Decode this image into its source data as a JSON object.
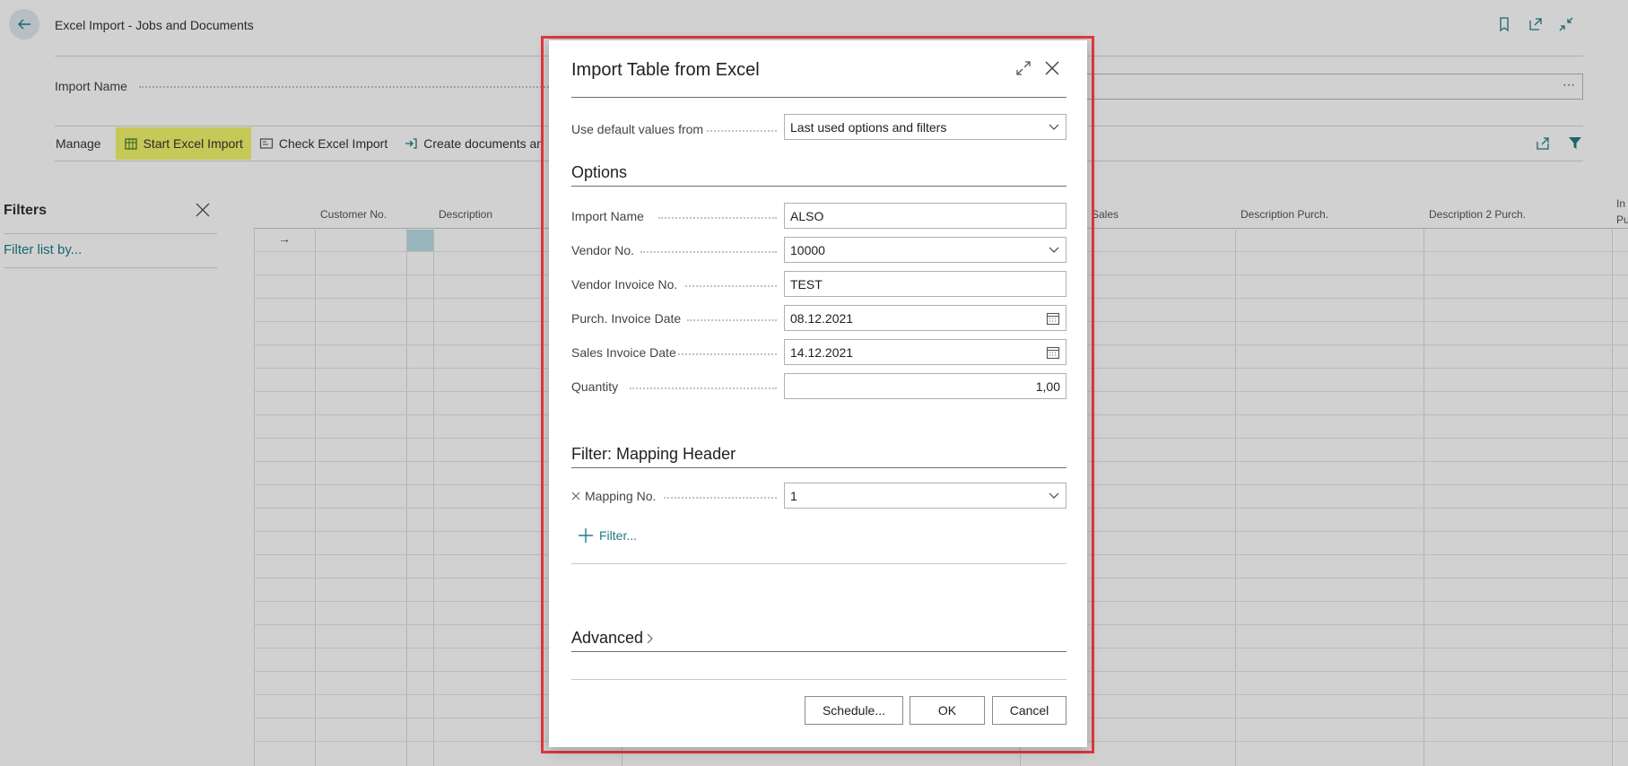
{
  "page": {
    "title": "Excel Import - Jobs and Documents",
    "import_name_label": "Import Name",
    "import_name_value": "⋯",
    "actions": {
      "manage": "Manage",
      "start": "Start Excel Import",
      "check": "Check Excel Import",
      "create": "Create documents an"
    },
    "filters_title": "Filters",
    "filter_link": "Filter list by...",
    "columns": [
      "Customer No.",
      "Description",
      "Sales",
      "Description Purch.",
      "Description 2 Purch.",
      "In Pu"
    ],
    "row_marker": "→"
  },
  "dialog": {
    "title": "Import Table from Excel",
    "default_label": "Use default values from",
    "default_value": "Last used options and filters",
    "options_title": "Options",
    "fields": [
      {
        "label": "Import Name",
        "value": "ALSO"
      },
      {
        "label": "Vendor No.",
        "value": "10000"
      },
      {
        "label": "Vendor Invoice No.",
        "value": "TEST"
      },
      {
        "label": "Purch. Invoice Date",
        "value": "08.12.2021"
      },
      {
        "label": "Sales Invoice Date",
        "value": "14.12.2021"
      },
      {
        "label": "Quantity",
        "value": "1,00"
      }
    ],
    "filter_section_title": "Filter: Mapping Header",
    "mapping_label": "Mapping No.",
    "mapping_value": "1",
    "add_filter": "Filter...",
    "advanced_title": "Advanced",
    "buttons": {
      "schedule": "Schedule...",
      "ok": "OK",
      "cancel": "Cancel"
    }
  },
  "colors": {
    "accent": "#1e7d87",
    "highlight": "#f2f56c",
    "frame": "#e0393e"
  }
}
